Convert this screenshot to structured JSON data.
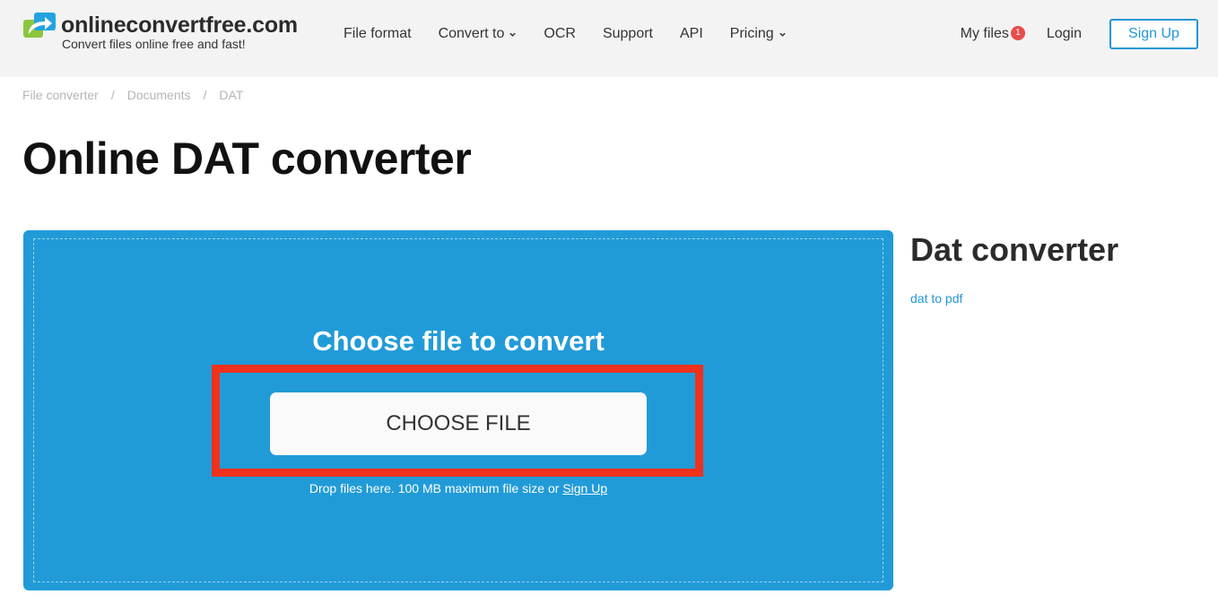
{
  "header": {
    "logo_name": "onlineconvertfree.com",
    "logo_tagline": "Convert files online free and fast!",
    "nav": [
      {
        "label": "File format",
        "dropdown": false
      },
      {
        "label": "Convert to",
        "dropdown": true
      },
      {
        "label": "OCR",
        "dropdown": false
      },
      {
        "label": "Support",
        "dropdown": false
      },
      {
        "label": "API",
        "dropdown": false
      },
      {
        "label": "Pricing",
        "dropdown": true
      }
    ],
    "my_files_label": "My files",
    "my_files_count": "1",
    "login_label": "Login",
    "signup_label": "Sign Up"
  },
  "breadcrumb": {
    "items": [
      "File converter",
      "Documents",
      "DAT"
    ],
    "separator": "/"
  },
  "page_title": "Online DAT converter",
  "upload": {
    "title": "Choose file to convert",
    "button_label": "CHOOSE FILE",
    "hint_text": "Drop files here. 100 MB maximum file size or ",
    "hint_link": "Sign Up"
  },
  "sidebar": {
    "title": "Dat converter",
    "links": [
      "dat to pdf"
    ]
  },
  "colors": {
    "accent": "#2396d5",
    "drop_zone": "#219bd8",
    "highlight": "#f0311c",
    "badge": "#e84c4c",
    "header_bg": "#f3f3f4"
  },
  "icons": {
    "logo": "swap-arrow-icon",
    "dropdown": "chevron-down-icon"
  }
}
